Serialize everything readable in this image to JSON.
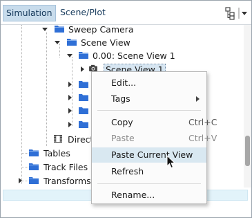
{
  "tabs": [
    {
      "label": "Simulation",
      "active": true
    },
    {
      "label": "Scene/Plot",
      "active": false
    }
  ],
  "toolbar": {
    "tree_view_icon": "hierarchy-icon",
    "dropdown_icon": "chevron-down-icon"
  },
  "tree": {
    "nodes": [
      {
        "label": "Sweep Camera",
        "expanded": true
      },
      {
        "label": "Scene View",
        "expanded": true
      },
      {
        "label": "0.00: Scene View 1",
        "expanded": true
      },
      {
        "label": "Scene View 1",
        "selected": true
      },
      {
        "label": "Directed Mesh",
        "visible_label": "Direct"
      },
      {
        "label": "Tables"
      },
      {
        "label": "Track Files"
      },
      {
        "label": "Transforms"
      }
    ]
  },
  "context_menu": {
    "items": [
      {
        "label": "Edit...",
        "shortcut": ""
      },
      {
        "label": "Tags",
        "shortcut": "",
        "submenu": true
      },
      {
        "label": "Copy",
        "shortcut": "Ctrl+C"
      },
      {
        "label": "Paste",
        "shortcut": "Ctrl+V",
        "disabled": true
      },
      {
        "label": "Paste Current View",
        "shortcut": "",
        "hover": true
      },
      {
        "label": "Refresh",
        "shortcut": ""
      },
      {
        "label": "Rename...",
        "shortcut": ""
      }
    ]
  },
  "colors": {
    "folder": "#2f6fd6",
    "selection": "#d7e6f2",
    "tab_active": "#c8dcec",
    "menu_hover": "#d9e8f1"
  }
}
